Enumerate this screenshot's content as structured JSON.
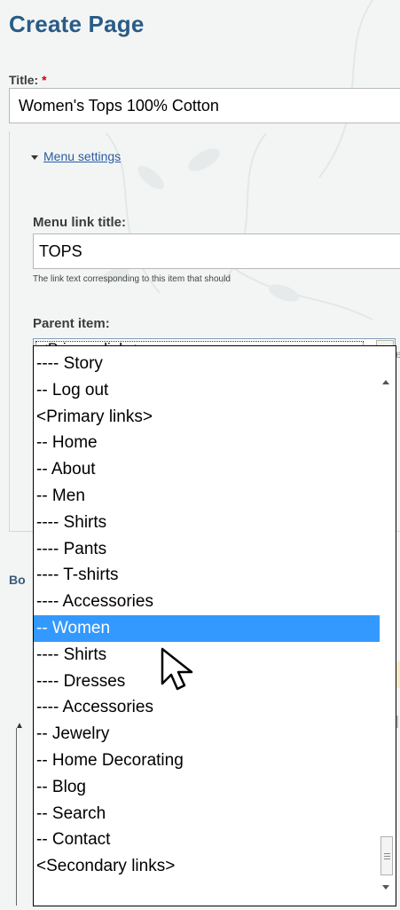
{
  "page": {
    "title": "Create Page"
  },
  "title_field": {
    "label": "Title:",
    "required_mark": "*",
    "value": "Women's Tops 100% Cotton"
  },
  "menu_settings": {
    "legend": "Menu settings",
    "link_title_label": "Menu link title:",
    "link_title_value": "TOPS",
    "help_text": "The link text corresponding to this item that should",
    "parent_label": "Parent item:",
    "parent_selected": "<Primary links>"
  },
  "dropdown": {
    "options": [
      "---- Story",
      "-- Log out",
      "<Primary links>",
      "-- Home",
      "-- About",
      "-- Men",
      "---- Shirts",
      "---- Pants",
      "---- T-shirts",
      "---- Accessories",
      "-- Women",
      "---- Shirts",
      "---- Dresses",
      "---- Accessories",
      "-- Jewelry",
      "-- Home Decorating",
      "-- Blog",
      "-- Search",
      "-- Contact",
      "<Secondary links>"
    ],
    "highlighted": "-- Women"
  },
  "partial": {
    "bo": "Bo",
    "e": "e"
  },
  "icons": {
    "legend": "triangle-down-icon",
    "select": "chevron-down-icon",
    "cursor": "mouse-pointer-icon"
  },
  "colors": {
    "title": "#2a5b86",
    "link": "#2a5ba0",
    "highlight": "#3399ff",
    "required": "#cc0000"
  }
}
